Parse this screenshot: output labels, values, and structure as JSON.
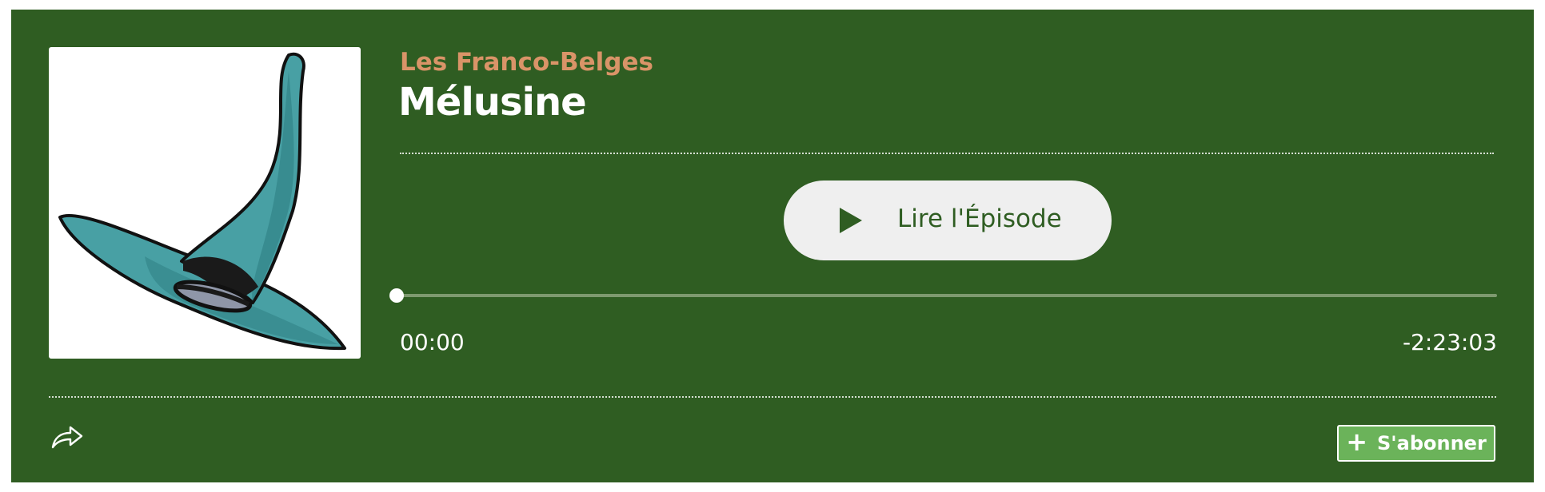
{
  "podcast": {
    "name": "Les Franco-Belges"
  },
  "episode": {
    "title": "Mélusine"
  },
  "player": {
    "play_label": "Lire l'Épisode",
    "elapsed": "00:00",
    "remaining": "-2:23:03",
    "progress": 0
  },
  "footer": {
    "share_icon": "share-arrow-icon",
    "subscribe_label": "S'abonner",
    "subscribe_icon": "plus-icon"
  },
  "colors": {
    "background": "#2f5d22",
    "podcast_name": "#d99468",
    "play_button_bg": "#efefef",
    "subscribe_bg": "#6bb35a"
  }
}
